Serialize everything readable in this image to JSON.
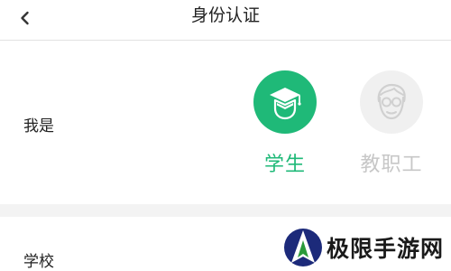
{
  "header": {
    "title": "身份认证",
    "back_icon": "chevron-left-icon"
  },
  "identity": {
    "label": "我是",
    "options": [
      {
        "label": "学生",
        "icon": "graduation-cap-icon",
        "selected": true
      },
      {
        "label": "教职工",
        "icon": "teacher-glasses-icon",
        "selected": false
      }
    ]
  },
  "school": {
    "label": "学校"
  },
  "watermark": {
    "text": "极限手游网"
  },
  "colors": {
    "accent": "#1fb978",
    "inactive_circle": "#f0f0f0",
    "inactive_text": "#c7c7c7",
    "separator": "#f3f3f3",
    "text": "#222222"
  }
}
